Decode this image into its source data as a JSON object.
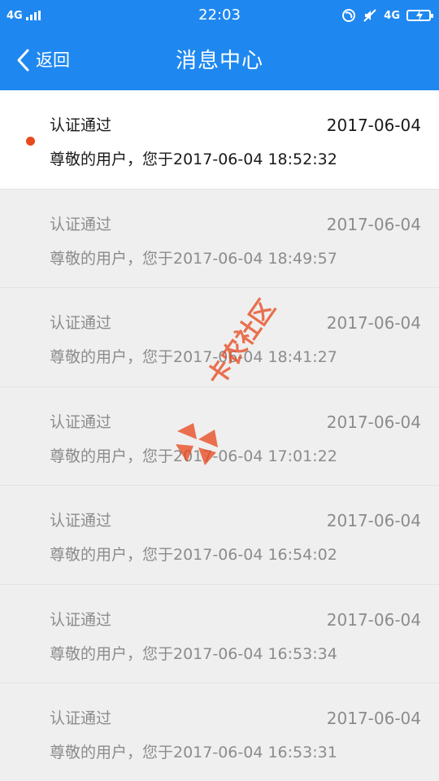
{
  "status_bar": {
    "network_left": "4G",
    "time": "22:03",
    "network_right": "4G",
    "icons": [
      "signal-bars-icon",
      "do-not-disturb-icon",
      "mute-icon",
      "battery-charging-icon"
    ]
  },
  "header": {
    "back_label": "返回",
    "title": "消息中心",
    "background_color": "#1f88f0"
  },
  "messages": [
    {
      "title": "认证通过",
      "date": "2017-06-04",
      "body": "尊敬的用户，您于2017-06-04 18:52:32",
      "unread": true
    },
    {
      "title": "认证通过",
      "date": "2017-06-04",
      "body": "尊敬的用户，您于2017-06-04 18:49:57",
      "unread": false
    },
    {
      "title": "认证通过",
      "date": "2017-06-04",
      "body": "尊敬的用户，您于2017-06-04 18:41:27",
      "unread": false
    },
    {
      "title": "认证通过",
      "date": "2017-06-04",
      "body": "尊敬的用户，您于2017-06-04 17:01:22",
      "unread": false
    },
    {
      "title": "认证通过",
      "date": "2017-06-04",
      "body": "尊敬的用户，您于2017-06-04 16:54:02",
      "unread": false
    },
    {
      "title": "认证通过",
      "date": "2017-06-04",
      "body": "尊敬的用户，您于2017-06-04 16:53:34",
      "unread": false
    },
    {
      "title": "认证通过",
      "date": "2017-06-04",
      "body": "尊敬的用户，您于2017-06-04 16:53:31",
      "unread": false
    }
  ],
  "watermark": {
    "text": "卡农社区",
    "color": "#e8491d"
  },
  "colors": {
    "unread_dot": "#e8491d",
    "read_background": "#efefef"
  }
}
